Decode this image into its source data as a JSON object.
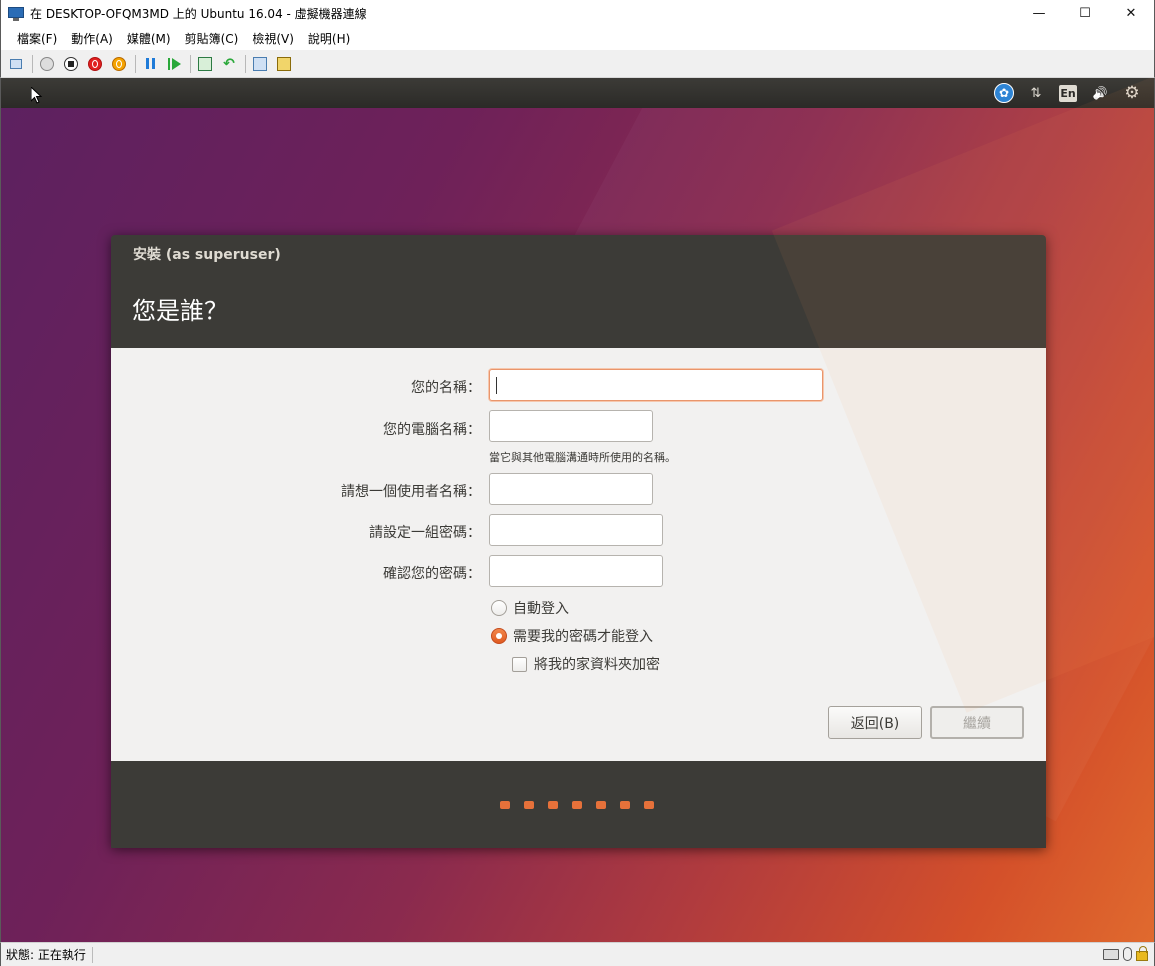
{
  "window": {
    "title": "在 DESKTOP-OFQM3MD 上的 Ubuntu 16.04 - 虛擬機器連線",
    "minimize": "—",
    "maximize": "☐",
    "close": "✕"
  },
  "menubar": {
    "items": [
      "檔案(F)",
      "動作(A)",
      "媒體(M)",
      "剪貼簿(C)",
      "檢視(V)",
      "說明(H)"
    ]
  },
  "toolbar": {
    "icons": [
      "ctrl-alt-del-icon",
      "start-icon",
      "turn-off-icon",
      "shutdown-icon",
      "save-icon",
      "pause-icon",
      "resume-icon",
      "checkpoint-icon",
      "revert-icon",
      "enhanced-session-icon",
      "share-icon"
    ]
  },
  "ubuntu_panel": {
    "accessibility_glyph": "✿",
    "network_glyph": "⇅",
    "keyboard_layout": "En",
    "sound_glyph": "🔊",
    "settings_glyph": "⚙"
  },
  "installer": {
    "window_title": "安裝 (as superuser)",
    "heading": "您是誰？",
    "fields": {
      "name_label": "您的名稱：",
      "name_value": "",
      "computer_label": "您的電腦名稱：",
      "computer_value": "",
      "computer_hint": "當它與其他電腦溝通時所使用的名稱。",
      "username_label": "請想一個使用者名稱：",
      "username_value": "",
      "password_label": "請設定一組密碼：",
      "password_value": "",
      "confirm_label": "確認您的密碼：",
      "confirm_value": ""
    },
    "options": {
      "auto_login": "自動登入",
      "require_password": "需要我的密碼才能登入",
      "encrypt_home": "將我的家資料夾加密",
      "selected": "require_password",
      "encrypt_checked": false
    },
    "buttons": {
      "back": "返回(B)",
      "continue": "繼續"
    },
    "progress_steps": 7
  },
  "statusbar": {
    "status": "狀態: 正在執行"
  },
  "colors": {
    "accent": "#e6713a",
    "panel": "#3c3b37",
    "body": "#f2f1f0"
  }
}
